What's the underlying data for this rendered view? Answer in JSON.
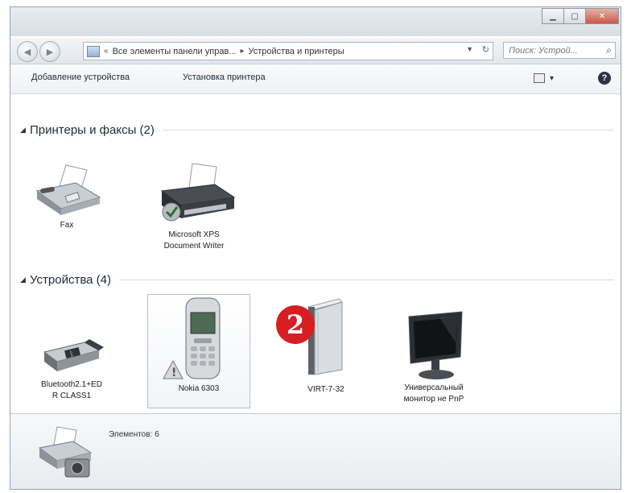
{
  "nav": {
    "breadcrumb_prefix": "«",
    "crumb_1": "Все элементы панели управ...",
    "crumb_sep": "▸",
    "crumb_2": "Устройства и принтеры",
    "search_placeholder": "Поиск: Устрой..."
  },
  "toolbar": {
    "add_device": "Добавление устройства",
    "add_printer": "Установка принтера"
  },
  "groups": {
    "printers": {
      "label": "Принтеры и факсы (2)"
    },
    "devices": {
      "label": "Устройства (4)"
    }
  },
  "printers": [
    {
      "label": "Fax",
      "icon": "fax-icon"
    },
    {
      "label": "Microsoft XPS\nDocument Writer",
      "icon": "printer-icon"
    }
  ],
  "devices": [
    {
      "label": "Bluetooth2.1+ED\nR CLASS1",
      "icon": "bluetooth-adapter-icon"
    },
    {
      "label": "Nokia 6303",
      "icon": "mobile-phone-icon"
    },
    {
      "label": "VIRT-7-32",
      "icon": "computer-icon"
    },
    {
      "label": "Универсальный\nмонитор не PnP",
      "icon": "monitor-icon"
    }
  ],
  "annotation": {
    "number": "2",
    "color": "#d81e23"
  },
  "status": {
    "count": "Элементов: 6"
  }
}
